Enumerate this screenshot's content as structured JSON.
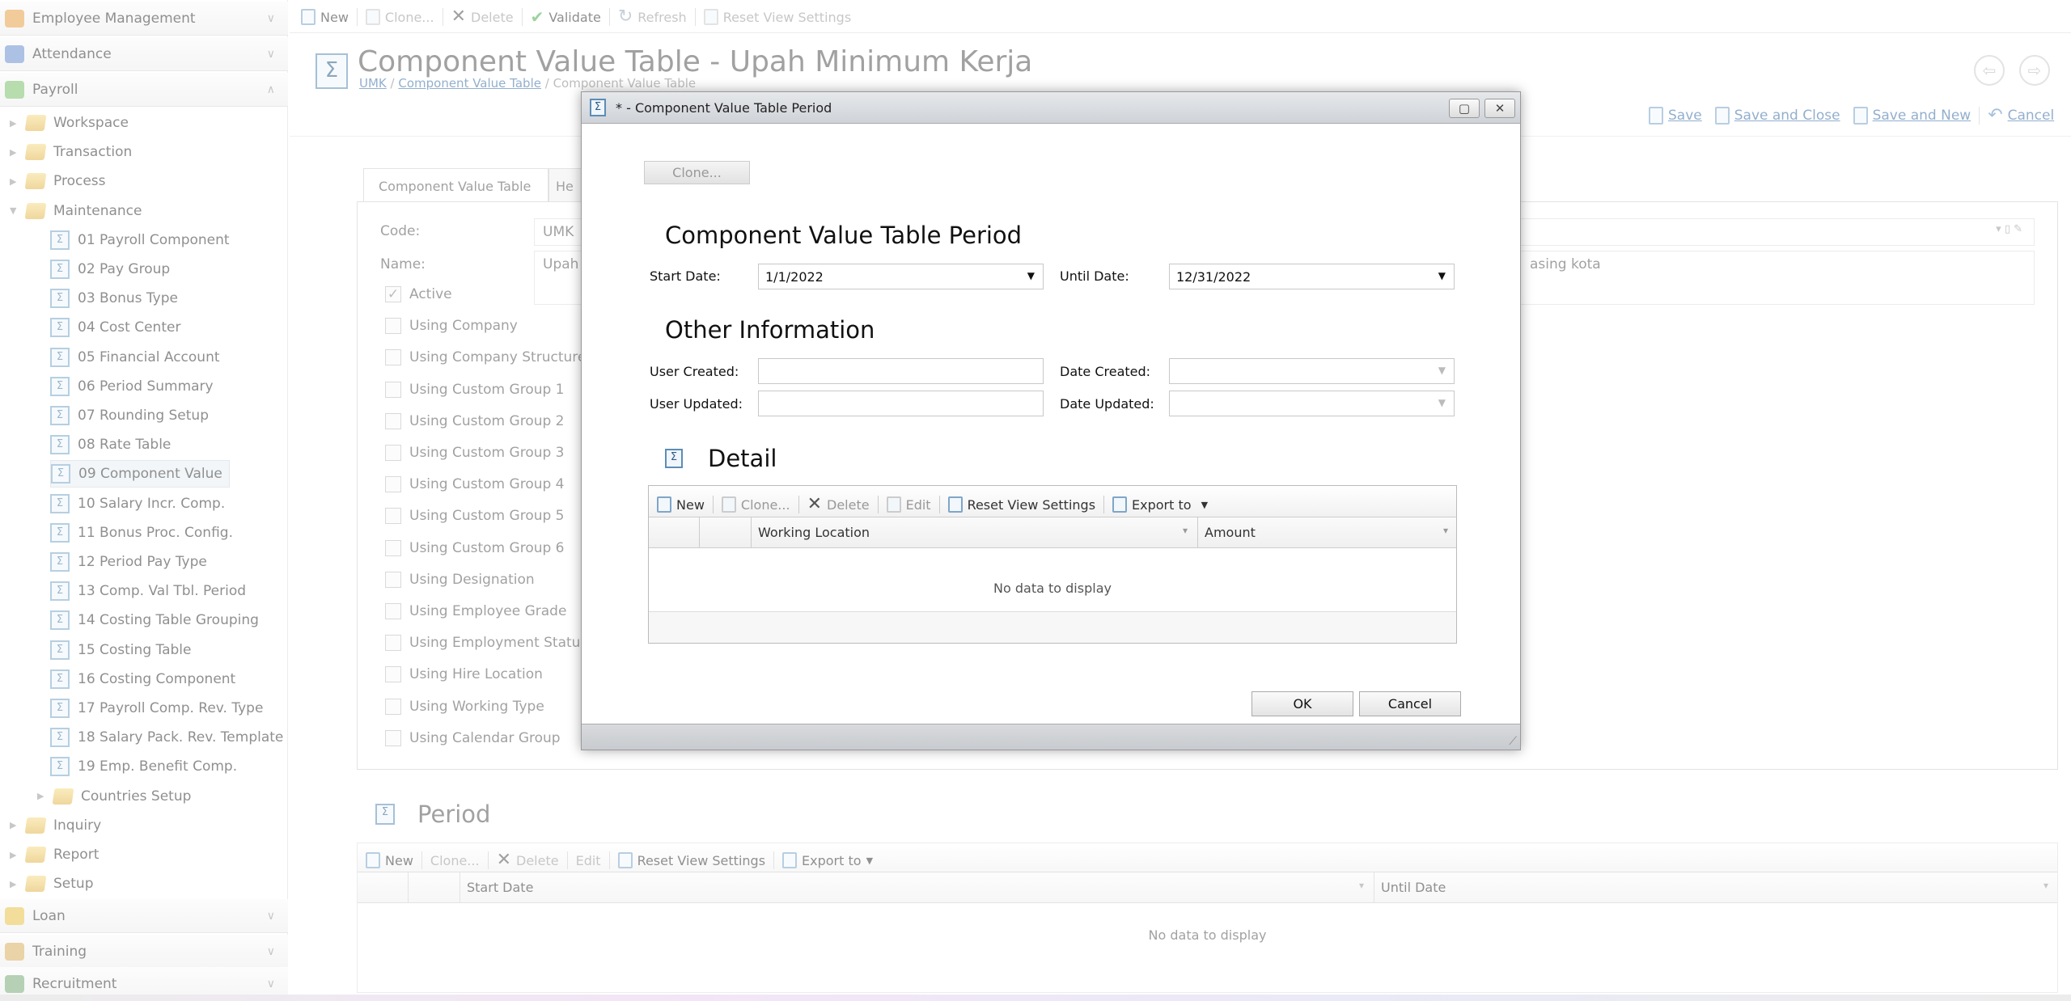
{
  "sidebar": {
    "groups_top": [
      {
        "label": "Employee Management",
        "icon": "users-icon",
        "color": "#e8a04a"
      },
      {
        "label": "Attendance",
        "icon": "clock-icon",
        "color": "#6a8fd0"
      },
      {
        "label": "Payroll",
        "icon": "money-icon",
        "color": "#7cbf6a"
      }
    ],
    "tree": [
      {
        "label": "Workspace",
        "type": "folder",
        "level": 0
      },
      {
        "label": "Transaction",
        "type": "folder",
        "level": 0
      },
      {
        "label": "Process",
        "type": "folder",
        "level": 0
      },
      {
        "label": "Maintenance",
        "type": "folder",
        "level": 0,
        "expanded": true
      },
      {
        "label": "01 Payroll Component",
        "type": "leaf",
        "level": 1
      },
      {
        "label": "02 Pay Group",
        "type": "leaf",
        "level": 1
      },
      {
        "label": "03 Bonus Type",
        "type": "leaf",
        "level": 1
      },
      {
        "label": "04 Cost Center",
        "type": "leaf",
        "level": 1
      },
      {
        "label": "05 Financial Account",
        "type": "leaf",
        "level": 1
      },
      {
        "label": "06 Period Summary",
        "type": "leaf",
        "level": 1
      },
      {
        "label": "07 Rounding Setup",
        "type": "leaf",
        "level": 1
      },
      {
        "label": "08 Rate Table",
        "type": "leaf",
        "level": 1
      },
      {
        "label": "09 Component Value",
        "type": "leaf",
        "level": 1,
        "selected": true
      },
      {
        "label": "10 Salary Incr. Comp.",
        "type": "leaf",
        "level": 1
      },
      {
        "label": "11 Bonus Proc. Config.",
        "type": "leaf",
        "level": 1
      },
      {
        "label": "12 Period Pay Type",
        "type": "leaf",
        "level": 1
      },
      {
        "label": "13 Comp. Val Tbl. Period",
        "type": "leaf",
        "level": 1
      },
      {
        "label": "14 Costing Table Grouping",
        "type": "leaf",
        "level": 1
      },
      {
        "label": "15 Costing Table",
        "type": "leaf",
        "level": 1
      },
      {
        "label": "16 Costing Component",
        "type": "leaf",
        "level": 1
      },
      {
        "label": "17 Payroll Comp. Rev. Type",
        "type": "leaf",
        "level": 1
      },
      {
        "label": "18 Salary Pack. Rev. Template",
        "type": "leaf",
        "level": 1
      },
      {
        "label": "19 Emp. Benefit Comp.",
        "type": "leaf",
        "level": 1
      },
      {
        "label": "Countries Setup",
        "type": "folder",
        "level": 1
      },
      {
        "label": "Inquiry",
        "type": "folder",
        "level": 0
      },
      {
        "label": "Report",
        "type": "folder",
        "level": 0
      },
      {
        "label": "Setup",
        "type": "folder",
        "level": 0
      }
    ],
    "groups_bottom": [
      {
        "label": "Loan",
        "icon": "loan-icon",
        "color": "#e8c14a"
      },
      {
        "label": "Training",
        "icon": "training-icon",
        "color": "#d9b060"
      },
      {
        "label": "Recruitment",
        "icon": "recruitment-icon",
        "color": "#7aaa7a"
      }
    ]
  },
  "toolbar": {
    "new": "New",
    "clone": "Clone...",
    "delete": "Delete",
    "validate": "Validate",
    "refresh": "Refresh",
    "reset": "Reset View Settings"
  },
  "page": {
    "title": "Component Value Table - Upah Minimum Kerja",
    "breadcrumb": [
      "UMK",
      "Component Value Table",
      "Component Value Table"
    ],
    "actions": {
      "save": "Save",
      "save_close": "Save and Close",
      "save_new": "Save and New",
      "cancel": "Cancel"
    },
    "tabs": [
      "Component Value Table",
      "He"
    ],
    "code_label": "Code:",
    "code_value": "UMK",
    "name_label": "Name:",
    "name_value": "Upah",
    "description_fragment": "asing kota",
    "checkboxes": [
      {
        "label": "Active",
        "checked": true
      },
      {
        "label": "Using Company",
        "checked": false
      },
      {
        "label": "Using Company Structure",
        "checked": false
      },
      {
        "label": "Using Custom Group 1",
        "checked": false
      },
      {
        "label": "Using Custom Group 2",
        "checked": false
      },
      {
        "label": "Using Custom Group 3",
        "checked": false
      },
      {
        "label": "Using Custom Group 4",
        "checked": false
      },
      {
        "label": "Using Custom Group 5",
        "checked": false
      },
      {
        "label": "Using Custom Group 6",
        "checked": false
      },
      {
        "label": "Using Designation",
        "checked": false
      },
      {
        "label": "Using Employee Grade",
        "checked": false
      },
      {
        "label": "Using Employment Status",
        "checked": false
      },
      {
        "label": "Using Hire Location",
        "checked": false
      },
      {
        "label": "Using Working Type",
        "checked": false
      },
      {
        "label": "Using Calendar Group",
        "checked": false
      }
    ],
    "period": {
      "title": "Period",
      "toolbar": {
        "new": "New",
        "clone": "Clone...",
        "delete": "Delete",
        "edit": "Edit",
        "reset": "Reset View Settings",
        "export": "Export to"
      },
      "columns": [
        "Start Date",
        "Until Date"
      ],
      "empty": "No data to display"
    }
  },
  "dialog": {
    "title": "* - Component Value Table Period",
    "clone": "Clone...",
    "section1": "Component Value Table Period",
    "start_label": "Start Date:",
    "start_value": "1/1/2022",
    "until_label": "Until Date:",
    "until_value": "12/31/2022",
    "section2": "Other Information",
    "user_created_label": "User Created:",
    "user_created_value": "",
    "date_created_label": "Date Created:",
    "date_created_value": "",
    "user_updated_label": "User Updated:",
    "user_updated_value": "",
    "date_updated_label": "Date Updated:",
    "date_updated_value": "",
    "detail_title": "Detail",
    "detail_toolbar": {
      "new": "New",
      "clone": "Clone...",
      "delete": "Delete",
      "edit": "Edit",
      "reset": "Reset View Settings",
      "export": "Export to"
    },
    "detail_columns": [
      "Working Location",
      "Amount"
    ],
    "detail_empty": "No data to display",
    "ok": "OK",
    "cancel": "Cancel"
  }
}
